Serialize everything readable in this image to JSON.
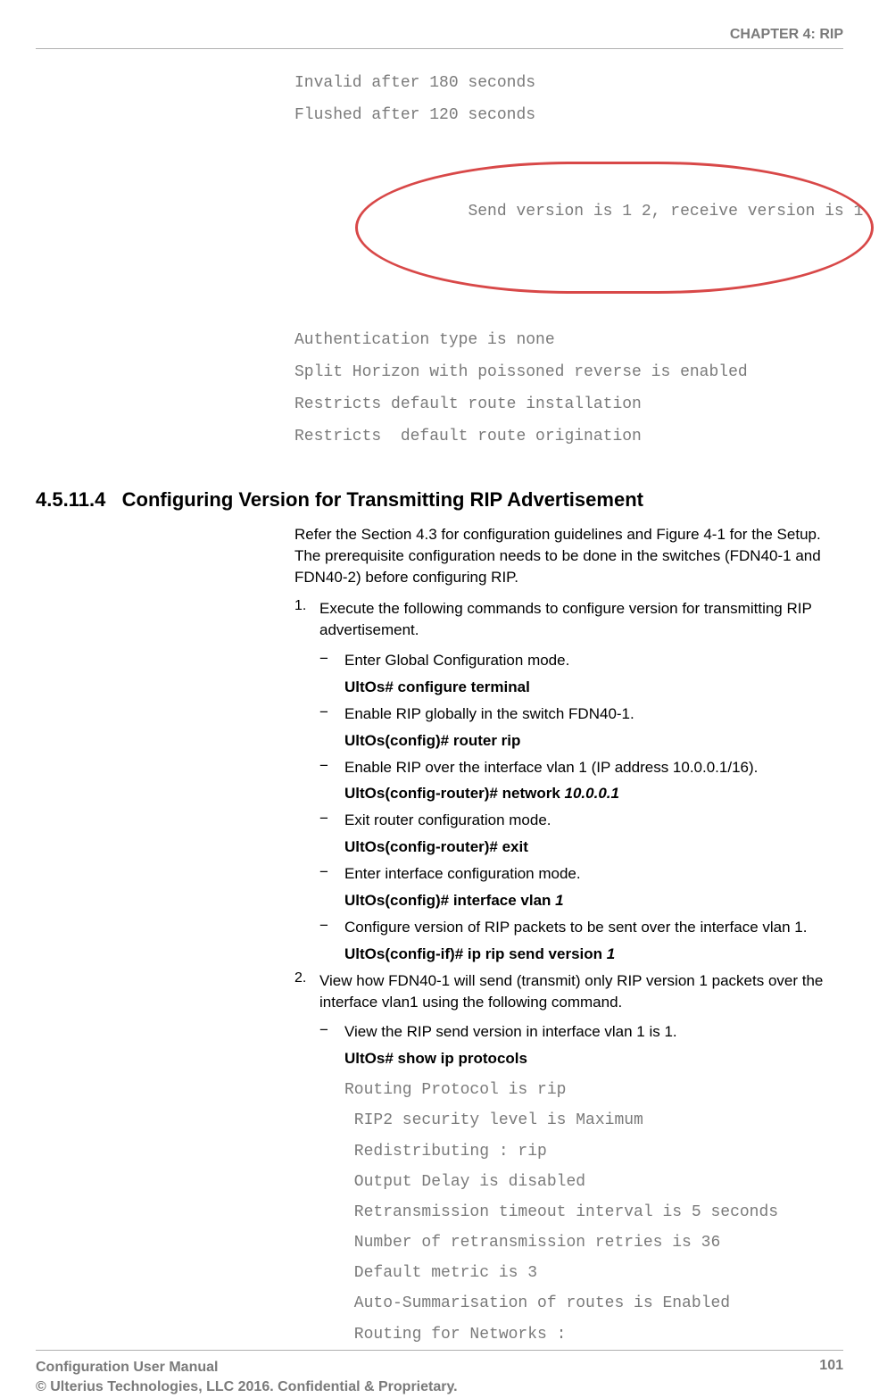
{
  "header": {
    "chapter": "CHAPTER 4: RIP"
  },
  "top_code": {
    "line1": "Invalid after 180 seconds",
    "line2": "Flushed after 120 seconds",
    "circled": "Send version is 1 2, receive version is 1",
    "line4": "Authentication type is none",
    "line5": "Split Horizon with poissoned reverse is enabled",
    "line6": "Restricts default route installation",
    "line7": "Restricts  default route origination"
  },
  "section": {
    "number": "4.5.11.4",
    "title": "Configuring Version for Transmitting RIP Advertisement"
  },
  "intro": "Refer the Section 4.3 for configuration guidelines and Figure 4-1 for the Setup. The prerequisite configuration needs to be done in the switches (FDN40-1 and FDN40-2) before configuring RIP.",
  "step1": {
    "num": "1.",
    "text": "Execute the following commands to configure version for transmitting RIP advertisement.",
    "items": [
      {
        "desc": "Enter Global Configuration mode.",
        "cmd": "UltOs# configure terminal",
        "arg": ""
      },
      {
        "desc": "Enable RIP globally in the switch FDN40-1.",
        "cmd": "UltOs(config)# router rip",
        "arg": ""
      },
      {
        "desc": "Enable RIP over the interface vlan 1 (IP address 10.0.0.1/16).",
        "cmd": "UltOs(config-router)# network ",
        "arg": "10.0.0.1"
      },
      {
        "desc": "Exit router configuration mode.",
        "cmd": "UltOs(config-router)# exit",
        "arg": ""
      },
      {
        "desc": "Enter interface configuration mode.",
        "cmd": "UltOs(config)# interface vlan ",
        "arg": "1"
      },
      {
        "desc": "Configure version of RIP packets to be sent over the interface vlan 1.",
        "cmd": "UltOs(config-if)# ip rip send version ",
        "arg": "1"
      }
    ]
  },
  "step2": {
    "num": "2.",
    "text": "View how FDN40-1 will send (transmit) only RIP version 1 packets over the interface vlan1 using the following command.",
    "desc": "View the RIP send version in interface vlan 1 is 1.",
    "cmd": "UltOs# show ip protocols",
    "output": [
      "Routing Protocol is rip",
      " RIP2 security level is Maximum",
      " Redistributing : rip",
      " Output Delay is disabled",
      " Retransmission timeout interval is 5 seconds",
      " Number of retransmission retries is 36",
      " Default metric is 3",
      " Auto-Summarisation of routes is Enabled",
      " Routing for Networks :"
    ]
  },
  "footer": {
    "line1": "Configuration User Manual",
    "line2": "© Ulterius Technologies, LLC 2016. Confidential & Proprietary.",
    "page": "101"
  }
}
